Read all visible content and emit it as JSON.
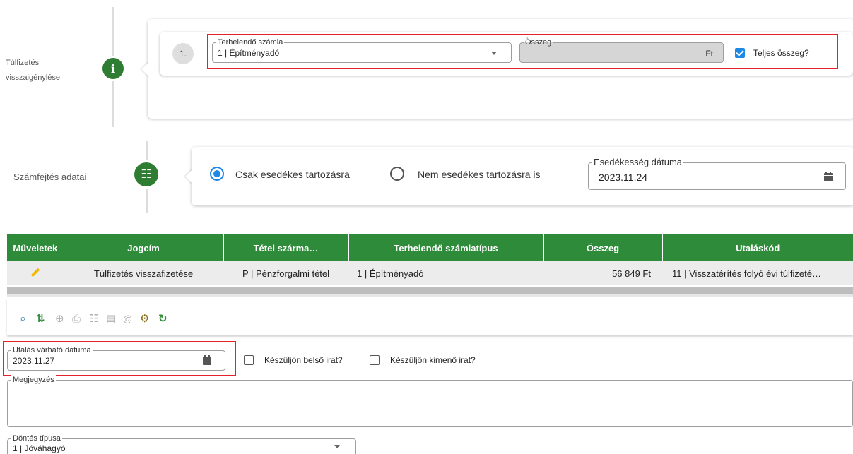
{
  "section1": {
    "label_line1": "Túlfizetés",
    "label_line2": "visszaigénylése",
    "icon_char": "i",
    "row_number": "1.",
    "account_field": {
      "label": "Terhelendő számla",
      "value": "1 | Építményadó"
    },
    "amount_field": {
      "label": "Összeg",
      "value": "",
      "currency": "Ft"
    },
    "full_amount_checkbox": {
      "label": "Teljes összeg?",
      "checked": true
    }
  },
  "section2": {
    "label": "Számfejtés adatai",
    "icon_char": "☷",
    "radio_due_only": {
      "label": "Csak esedékes tartozásra",
      "selected": true
    },
    "radio_not_due": {
      "label": "Nem esedékes tartozásra is",
      "selected": false
    },
    "due_date_field": {
      "label": "Esedékesség dátuma",
      "value": "2023.11.24"
    }
  },
  "table": {
    "columns": [
      "Műveletek",
      "Jogcím",
      "Tétel szárma…",
      "Terhelendő számlatípus",
      "Összeg",
      "Utaláskód"
    ],
    "rows": [
      [
        "",
        "Túlfizetés visszafizetése",
        "P | Pénzforgalmi tétel",
        "1 | Építményadó",
        "56 849 Ft",
        "11 | Visszatérítés folyó évi túlfizeté…"
      ]
    ]
  },
  "toolbar": {
    "icons": [
      "search-icon",
      "swap-icon",
      "add-icon",
      "print-icon",
      "document-icon",
      "document-filled-icon",
      "at-icon",
      "gears-icon",
      "refresh-icon"
    ]
  },
  "bottom": {
    "transfer_date_field": {
      "label": "Utalás várható dátuma",
      "value": "2023.11.27"
    },
    "internal_doc_checkbox": {
      "label": "Készüljön belső irat?",
      "checked": false
    },
    "outgoing_doc_checkbox": {
      "label": "Készüljön kimenő irat?",
      "checked": false
    },
    "note_field": {
      "label": "Megjegyzés",
      "value": ""
    },
    "decision_field": {
      "label": "Döntés típusa",
      "value": "1 | Jóváhagyó"
    }
  },
  "colors": {
    "accent_green": "#2e8b3a",
    "step_green": "#2e7d32",
    "highlight_red": "#e3222c",
    "check_blue": "#1e88e5"
  }
}
